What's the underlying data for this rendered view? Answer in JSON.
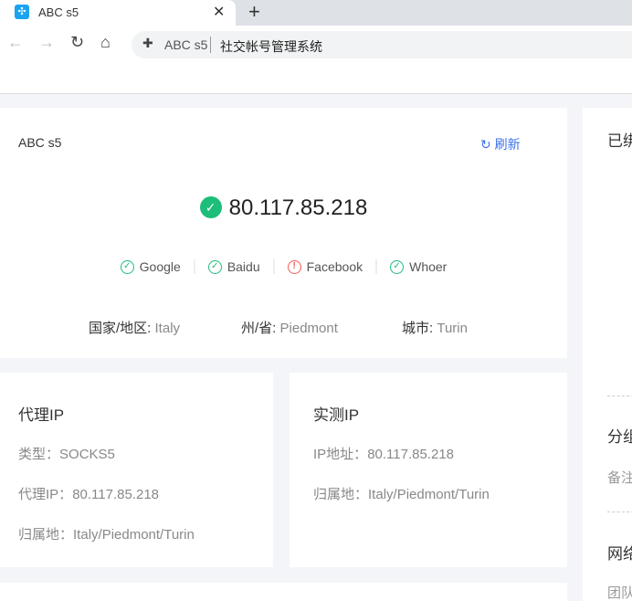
{
  "browser": {
    "tab_title": "ABC s5",
    "omnibox_site": "ABC s5",
    "omnibox_title": "社交帐号管理系统"
  },
  "main_card": {
    "title": "ABC s5",
    "refresh": "刷新",
    "ip": "80.117.85.218",
    "tests": [
      {
        "name": "Google",
        "status": "ok"
      },
      {
        "name": "Baidu",
        "status": "ok"
      },
      {
        "name": "Facebook",
        "status": "error"
      },
      {
        "name": "Whoer",
        "status": "ok"
      }
    ],
    "country_label": "国家/地区:",
    "country": "Italy",
    "state_label": "州/省:",
    "state": "Piedmont",
    "city_label": "城市:",
    "city": "Turin"
  },
  "proxy_card": {
    "title": "代理IP",
    "type_label": "类型：",
    "type": "SOCKS5",
    "ip_label": "代理IP：",
    "ip": "80.117.85.218",
    "loc_label": "归属地：",
    "loc": "Italy/Piedmont/Turin"
  },
  "real_card": {
    "title": "实测IP",
    "ip_label": "IP地址：",
    "ip": "80.117.85.218",
    "loc_label": "归属地：",
    "loc": "Italy/Piedmont/Turin"
  },
  "side_card": {
    "bound": "已绑",
    "group": "分组",
    "note": "备注",
    "network": "网络",
    "team": "团队"
  },
  "colors": {
    "success": "#1dbd7a",
    "error": "#f25a5a",
    "link": "#3a6fe8"
  }
}
